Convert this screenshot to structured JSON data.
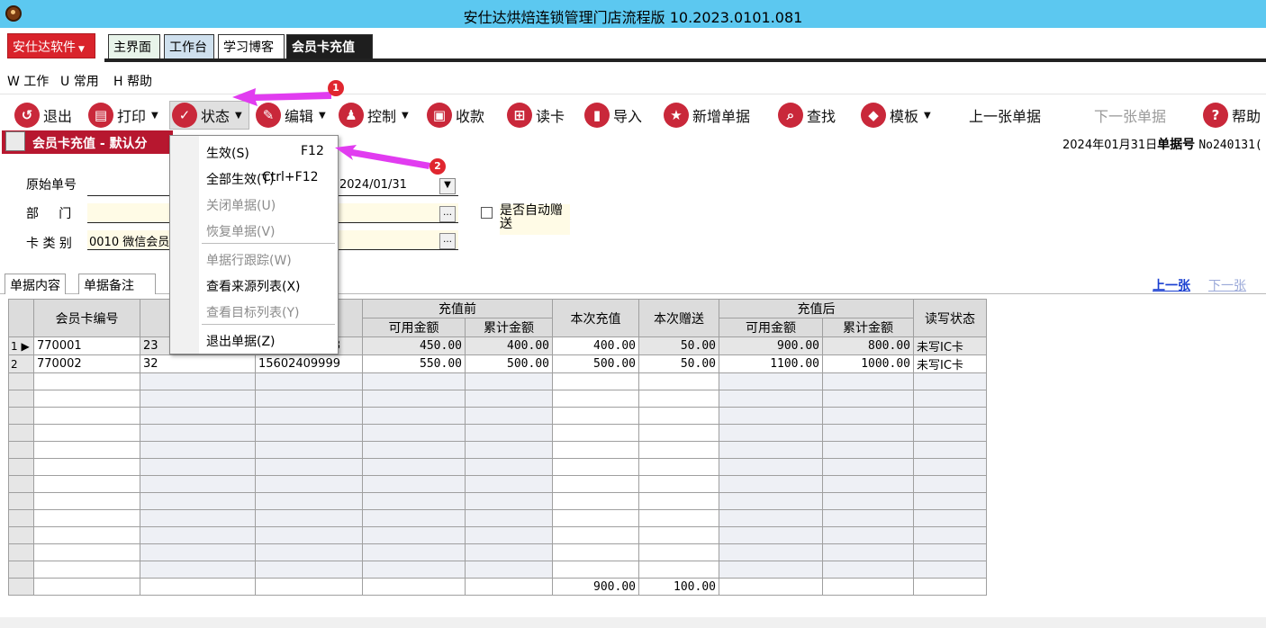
{
  "window": {
    "title": "安仕达烘焙连锁管理门店流程版   10.2023.0101.081"
  },
  "tabs": {
    "brand": "安仕达软件",
    "items": [
      "主界面",
      "工作台",
      "学习博客",
      "会员卡充值"
    ]
  },
  "menu": [
    "W 工作",
    "U 常用",
    "H 帮助"
  ],
  "toolbar": {
    "exit": "退出",
    "print": "打印",
    "status": "状态",
    "edit": "编辑",
    "control": "控制",
    "payment": "收款",
    "read_card": "读卡",
    "import": "导入",
    "new_doc": "新增单据",
    "find": "查找",
    "template": "模板",
    "prev_doc": "上一张单据",
    "next_doc": "下一张单据",
    "help": "帮助"
  },
  "form": {
    "title": "会员卡充值 - 默认分",
    "date_line": "2024年01月31日",
    "doc_no_label": "单据号",
    "doc_no": "No240131(",
    "orig_label": "原始单号",
    "dept_label": "部     门",
    "cardtype_label": "卡 类 别",
    "cardtype_value": "0010 微信会员",
    "date_value": "2024/01/31",
    "auto_gift_label": "是否自动赠送"
  },
  "subtabs": [
    "单据内容",
    "单据备注"
  ],
  "nav": {
    "prev": "上一张",
    "next": "下一张"
  },
  "grid": {
    "headers": {
      "card_no": "会员卡编号",
      "col2": "持",
      "before": "充值前",
      "avail": "可用金额",
      "total": "累计金额",
      "recharge": "本次充值",
      "gift": "本次赠送",
      "after": "充值后",
      "avail2": "可用金额",
      "total2": "累计金额",
      "rw": "读写状态"
    },
    "rows": [
      {
        "idx": "1",
        "card": "770001",
        "holder": "23",
        "phone": "15602408888",
        "avail": "450.00",
        "total": "400.00",
        "recharge": "400.00",
        "gift": "50.00",
        "avail2": "900.00",
        "total2": "800.00",
        "rw": "未写IC卡"
      },
      {
        "idx": "2",
        "card": "770002",
        "holder": "32",
        "phone": "15602409999",
        "avail": "550.00",
        "total": "500.00",
        "recharge": "500.00",
        "gift": "50.00",
        "avail2": "1100.00",
        "total2": "1000.00",
        "rw": "未写IC卡"
      }
    ],
    "footer": {
      "recharge": "900.00",
      "gift": "100.00"
    }
  },
  "popup": {
    "items": [
      {
        "label": "生效(S)",
        "shortcut": "F12",
        "enabled": true
      },
      {
        "label": "全部生效(T)",
        "shortcut": "Ctrl+F12",
        "enabled": true
      },
      {
        "label": "关闭单据(U)",
        "enabled": false
      },
      {
        "label": "恢复单据(V)",
        "enabled": false
      },
      {
        "label": "单据行跟踪(W)",
        "enabled": false
      },
      {
        "label": "查看来源列表(X)",
        "enabled": true
      },
      {
        "label": "查看目标列表(Y)",
        "enabled": false
      },
      {
        "label": "退出单据(Z)",
        "enabled": true
      }
    ]
  },
  "annotations": {
    "badge1": "1",
    "badge2": "2",
    "arrow_color": "#e13cf0"
  },
  "colors": {
    "titlebar": "#5cc8f0",
    "brand": "#d9232b",
    "form_title": "#b7172f",
    "icon": "#c9283a"
  }
}
